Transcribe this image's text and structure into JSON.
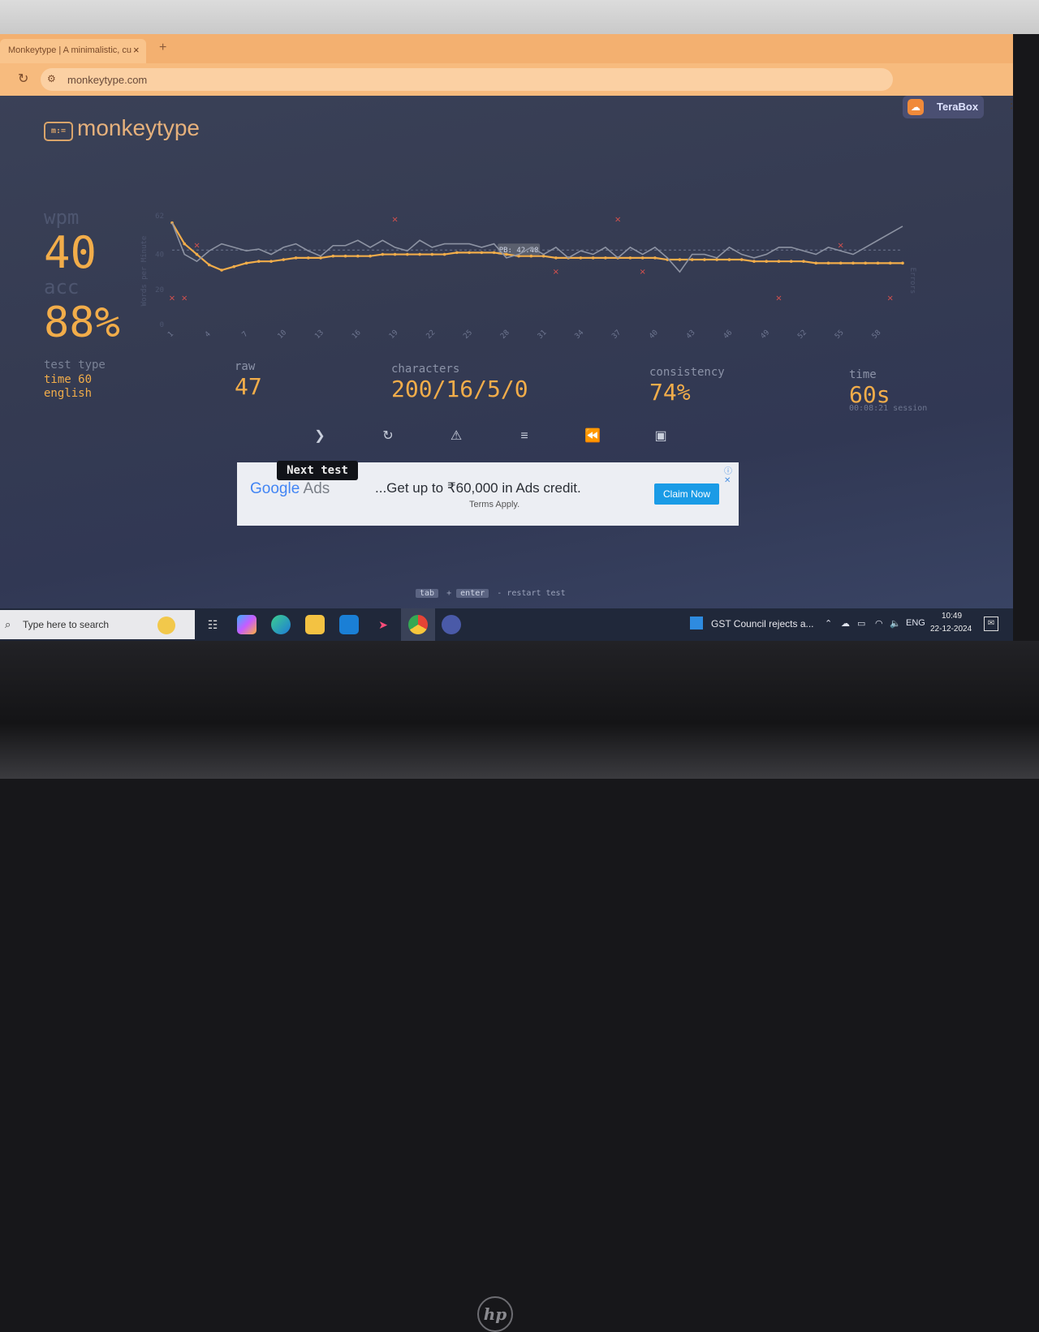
{
  "browser": {
    "tab_title": "Monkeytype | A minimalistic, cu",
    "tab_close": "×",
    "new_tab": "+",
    "url": "monkeytype.com",
    "extension_label": "TeraBox"
  },
  "app": {
    "logo_text": "monkeytype",
    "wpm_label": "wpm",
    "wpm": "40",
    "acc_label": "acc",
    "acc": "88%",
    "test_type_label": "test type",
    "test_type_lines": [
      "time 60",
      "english"
    ],
    "stats": {
      "raw_label": "raw",
      "raw": "47",
      "characters_label": "characters",
      "characters": "200/16/5/0",
      "consistency_label": "consistency",
      "consistency": "74%",
      "time_label": "time",
      "time": "60s",
      "session": "00:08:21 session"
    },
    "tooltip": "Next test",
    "shortcut_hint": {
      "key1": "tab",
      "plus": "+",
      "key2": "enter",
      "action": "- restart test"
    }
  },
  "ad": {
    "brand": "Google",
    "product": "Ads",
    "headline": "...Get up to ₹60,000 in Ads credit.",
    "terms": "Terms Apply.",
    "cta": "Claim Now"
  },
  "taskbar": {
    "search_placeholder": "Type here to search",
    "news": "GST Council rejects a...",
    "lang": "ENG",
    "time": "10:49",
    "date": "22-12-2024"
  },
  "chart_data": {
    "type": "line",
    "ylabel": "Words per Minute",
    "y2label": "Errors",
    "ylim": [
      0,
      62
    ],
    "yticks": [
      0,
      20,
      40,
      62
    ],
    "xticks": [
      1,
      4,
      7,
      10,
      13,
      16,
      19,
      22,
      25,
      28,
      31,
      34,
      37,
      40,
      43,
      46,
      49,
      52,
      55,
      58
    ],
    "pb_label": "PB: 42.48",
    "pb_value": 42.48,
    "series": [
      {
        "name": "wpm",
        "color": "#f2ad4a",
        "x": [
          1,
          2,
          3,
          4,
          5,
          6,
          7,
          8,
          9,
          10,
          11,
          12,
          13,
          14,
          15,
          16,
          17,
          18,
          19,
          20,
          21,
          22,
          23,
          24,
          25,
          26,
          27,
          28,
          29,
          30,
          31,
          32,
          33,
          34,
          35,
          36,
          37,
          38,
          39,
          40,
          41,
          42,
          43,
          44,
          45,
          46,
          47,
          48,
          49,
          50,
          51,
          52,
          53,
          54,
          55,
          56,
          57,
          58,
          59,
          60
        ],
        "values": [
          58,
          46,
          40,
          34,
          31,
          33,
          35,
          36,
          36,
          37,
          38,
          38,
          38,
          39,
          39,
          39,
          39,
          40,
          40,
          40,
          40,
          40,
          40,
          41,
          41,
          41,
          41,
          40,
          39,
          39,
          39,
          38,
          38,
          38,
          38,
          38,
          38,
          38,
          38,
          38,
          37,
          37,
          37,
          37,
          37,
          37,
          37,
          36,
          36,
          36,
          36,
          36,
          35,
          35,
          35,
          35,
          35,
          35,
          35,
          35
        ]
      },
      {
        "name": "raw",
        "color": "#8d93a3",
        "x": [
          1,
          2,
          3,
          4,
          5,
          6,
          7,
          8,
          9,
          10,
          11,
          12,
          13,
          14,
          15,
          16,
          17,
          18,
          19,
          20,
          21,
          22,
          23,
          24,
          25,
          26,
          27,
          28,
          29,
          30,
          31,
          32,
          33,
          34,
          35,
          36,
          37,
          38,
          39,
          40,
          41,
          42,
          43,
          44,
          45,
          46,
          47,
          48,
          49,
          50,
          51,
          52,
          53,
          54,
          55,
          56,
          57,
          58,
          59,
          60
        ],
        "values": [
          58,
          40,
          36,
          42,
          46,
          44,
          42,
          43,
          40,
          44,
          46,
          42,
          39,
          45,
          45,
          48,
          44,
          48,
          44,
          42,
          48,
          44,
          46,
          46,
          46,
          44,
          46,
          38,
          40,
          44,
          40,
          44,
          38,
          42,
          40,
          44,
          38,
          44,
          40,
          44,
          38,
          30,
          40,
          40,
          38,
          44,
          40,
          38,
          40,
          44,
          44,
          42,
          40,
          44,
          42,
          40,
          44,
          48,
          52,
          56
        ]
      },
      {
        "name": "errors",
        "color": "#e0524d",
        "x": [
          1,
          2,
          3,
          19,
          32,
          37,
          39,
          50,
          55,
          59
        ],
        "values": [
          1,
          1,
          3,
          4,
          2,
          4,
          2,
          1,
          3,
          1
        ]
      }
    ]
  }
}
